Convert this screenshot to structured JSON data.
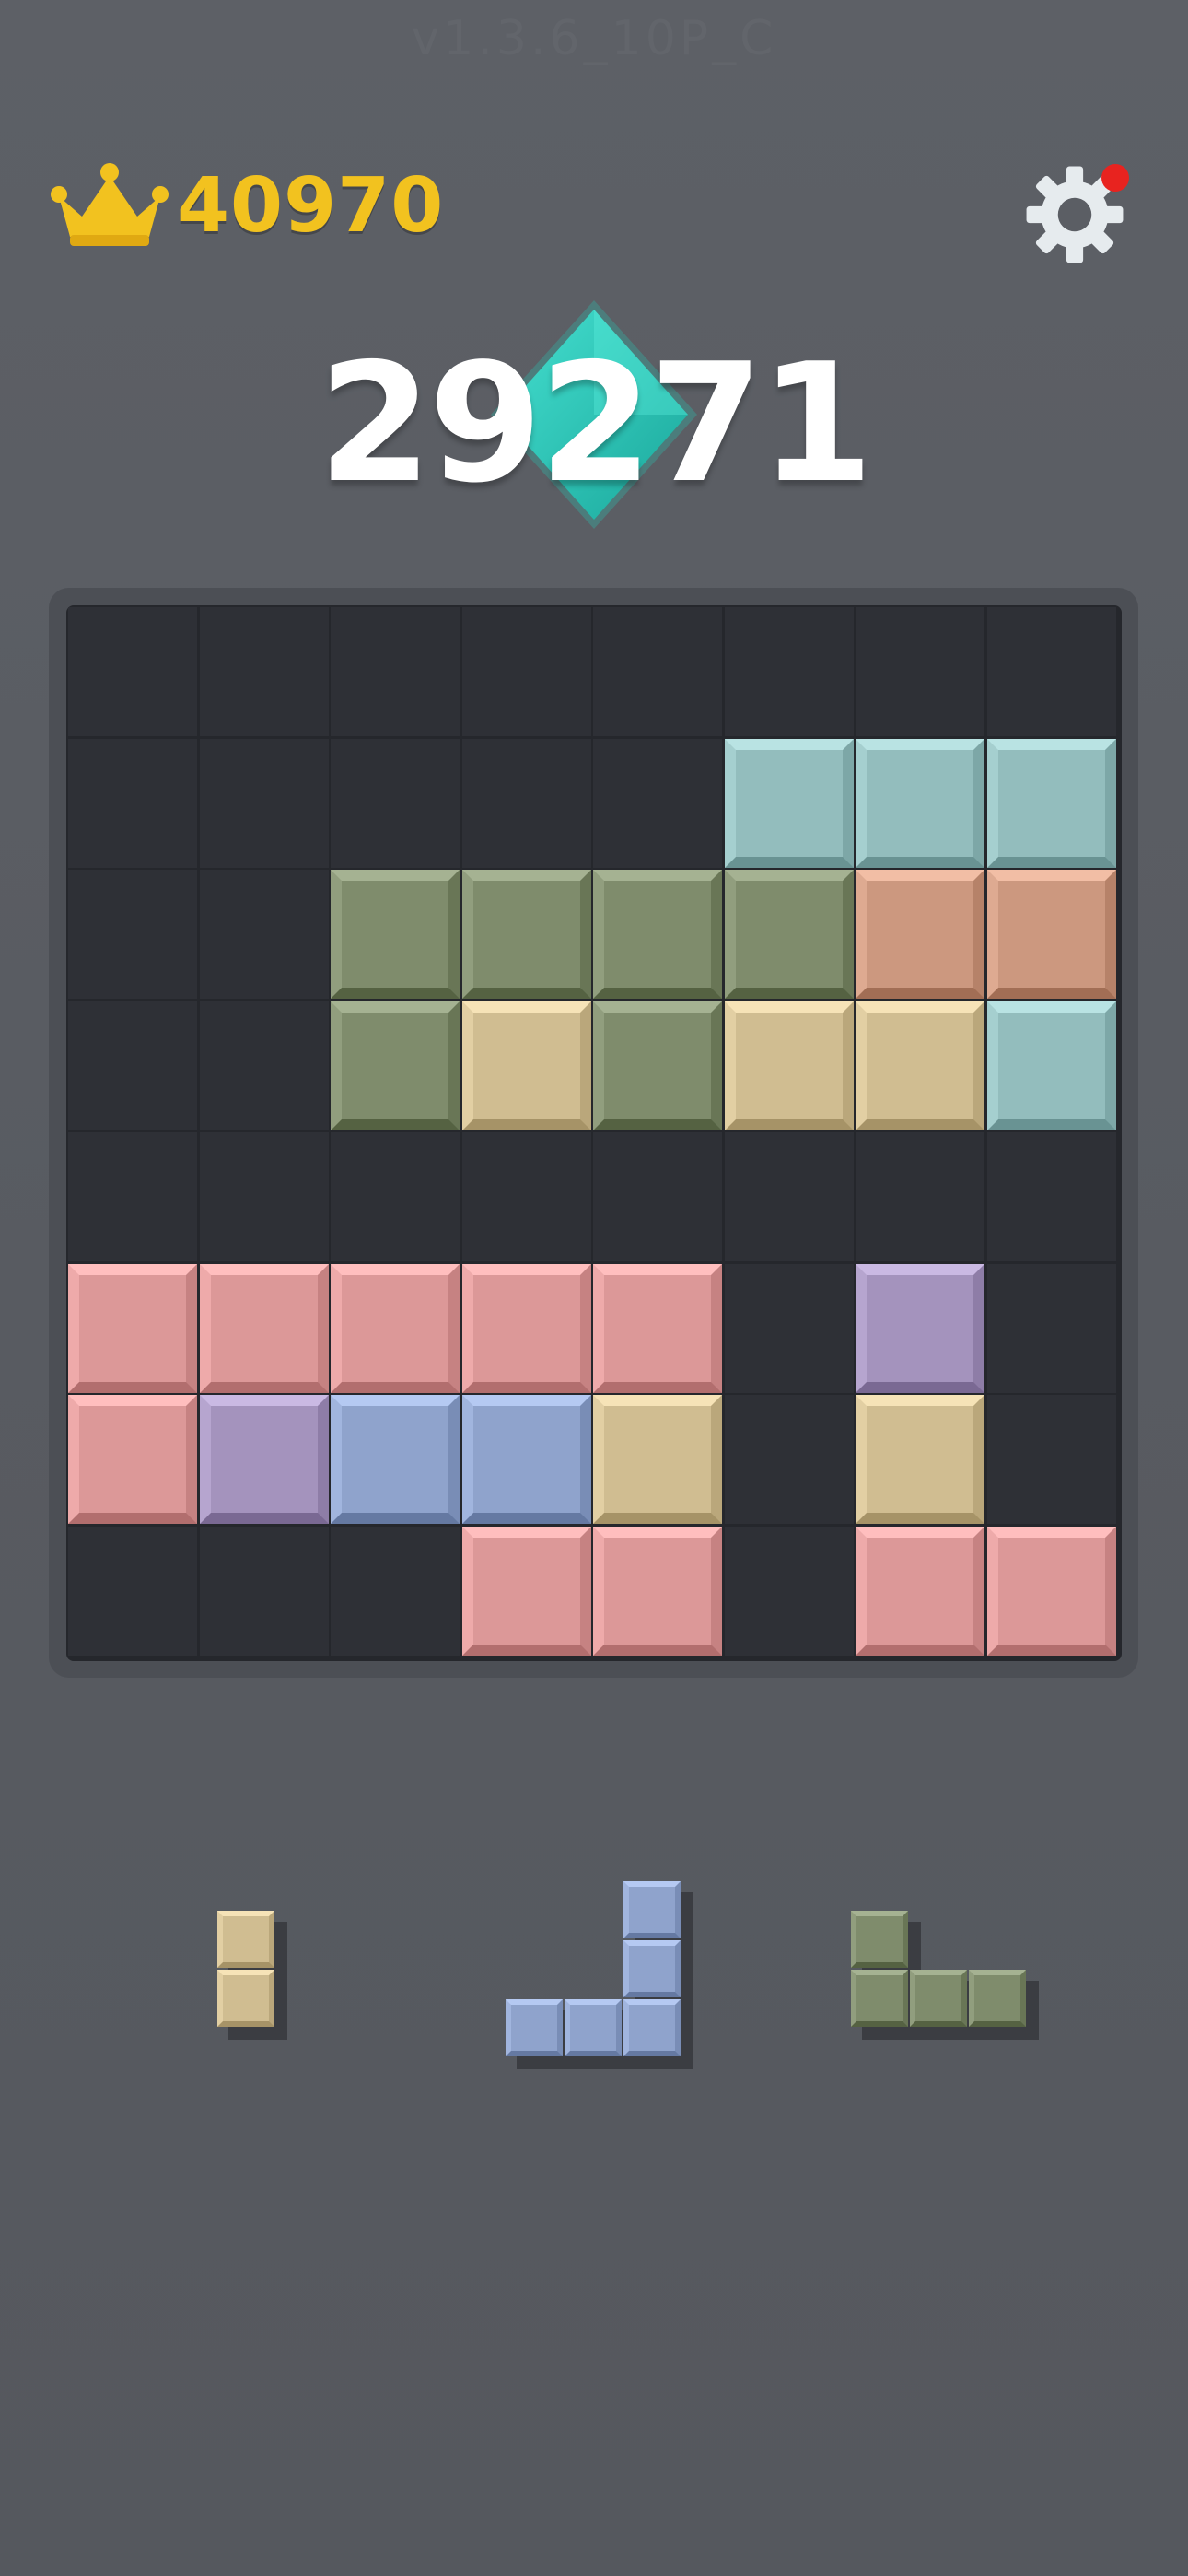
{
  "header": {
    "version_text": "v1.3.6_10P_C",
    "best_score": "40970",
    "crown_icon": "crown-icon",
    "settings_icon": "gear-icon",
    "notification": true
  },
  "score": {
    "current": "29271",
    "gem_icon": "diamond-gem-icon"
  },
  "colors": {
    "teal": "#93bdbd",
    "olive": "#7f8c6c",
    "orange": "#cc987f",
    "tan": "#d0bd91",
    "pink": "#dc9898",
    "purple": "#a493bd",
    "blue": "#8fa3cc"
  },
  "board": {
    "size": 8,
    "rows": [
      [
        "",
        "",
        "",
        "",
        "",
        "",
        "",
        ""
      ],
      [
        "",
        "",
        "",
        "",
        "",
        "teal",
        "teal",
        "teal"
      ],
      [
        "",
        "",
        "olive",
        "olive",
        "olive",
        "olive",
        "orange",
        "orange"
      ],
      [
        "",
        "",
        "olive",
        "tan",
        "olive",
        "tan",
        "tan",
        "teal"
      ],
      [
        "",
        "",
        "",
        "",
        "",
        "",
        "",
        ""
      ],
      [
        "pink",
        "pink",
        "pink",
        "pink",
        "pink",
        "",
        "purple",
        ""
      ],
      [
        "pink",
        "purple",
        "blue",
        "blue",
        "tan",
        "",
        "tan",
        ""
      ],
      [
        "",
        "",
        "",
        "pink",
        "pink",
        "",
        "pink",
        "pink"
      ]
    ]
  },
  "tray": [
    {
      "name": "piece-vertical-2-tan",
      "color": "tan",
      "cells": [
        [
          0,
          0
        ],
        [
          1,
          0
        ]
      ]
    },
    {
      "name": "piece-j-shape-blue",
      "color": "blue",
      "cells": [
        [
          0,
          2
        ],
        [
          1,
          2
        ],
        [
          2,
          0
        ],
        [
          2,
          1
        ],
        [
          2,
          2
        ]
      ]
    },
    {
      "name": "piece-l-shape-olive",
      "color": "olive",
      "cells": [
        [
          0,
          0
        ],
        [
          1,
          0
        ],
        [
          1,
          1
        ],
        [
          1,
          2
        ]
      ]
    }
  ]
}
